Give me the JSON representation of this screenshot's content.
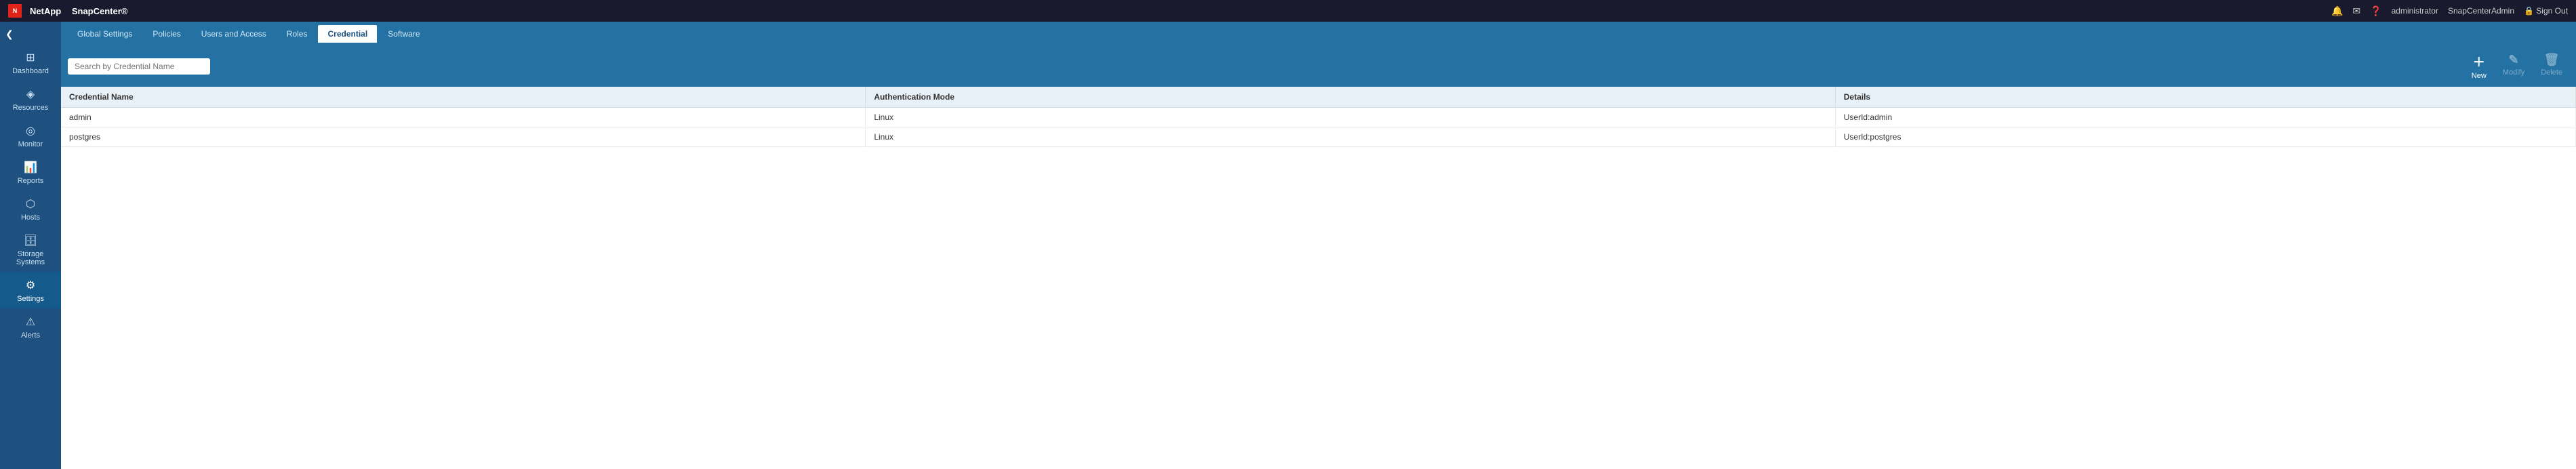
{
  "topbar": {
    "brand": "NetApp",
    "product": "SnapCenter®",
    "icons": {
      "bell": "🔔",
      "mail": "✉",
      "help": "❓"
    },
    "user": "administrator",
    "admin_link": "SnapCenterAdmin",
    "signout": "Sign Out"
  },
  "sidebar": {
    "collapse_icon": "❮",
    "items": [
      {
        "id": "dashboard",
        "label": "Dashboard",
        "icon": "⊞"
      },
      {
        "id": "resources",
        "label": "Resources",
        "icon": "◈"
      },
      {
        "id": "monitor",
        "label": "Monitor",
        "icon": "◎"
      },
      {
        "id": "reports",
        "label": "Reports",
        "icon": "📊"
      },
      {
        "id": "hosts",
        "label": "Hosts",
        "icon": "⬡"
      },
      {
        "id": "storage-systems",
        "label": "Storage Systems",
        "icon": "🗄"
      },
      {
        "id": "settings",
        "label": "Settings",
        "icon": "⚙",
        "active": true
      },
      {
        "id": "alerts",
        "label": "Alerts",
        "icon": "⚠"
      }
    ]
  },
  "tabs": [
    {
      "id": "global-settings",
      "label": "Global Settings"
    },
    {
      "id": "policies",
      "label": "Policies"
    },
    {
      "id": "users-and-access",
      "label": "Users and Access"
    },
    {
      "id": "roles",
      "label": "Roles"
    },
    {
      "id": "credential",
      "label": "Credential",
      "active": true
    },
    {
      "id": "software",
      "label": "Software"
    }
  ],
  "toolbar": {
    "search_placeholder": "Search by Credential Name",
    "new_btn": "New",
    "modify_btn": "Modify",
    "delete_btn": "Delete"
  },
  "table": {
    "columns": [
      {
        "id": "credential-name",
        "label": "Credential Name"
      },
      {
        "id": "auth-mode",
        "label": "Authentication Mode"
      },
      {
        "id": "details",
        "label": "Details"
      }
    ],
    "rows": [
      {
        "credential_name": "admin",
        "auth_mode": "Linux",
        "details": "UserId:admin"
      },
      {
        "credential_name": "postgres",
        "auth_mode": "Linux",
        "details": "UserId:postgres"
      }
    ]
  }
}
